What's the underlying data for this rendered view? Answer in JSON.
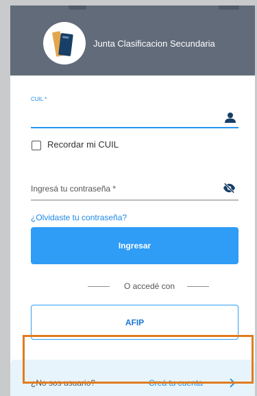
{
  "header": {
    "title": "Junta Clasificacion Secundaria",
    "logo_icon": "books-logo-icon"
  },
  "form": {
    "cuil_label": "CUIL *",
    "cuil_value": "",
    "cuil_icon": "person-icon",
    "remember_label": "Recordar mi CUIL",
    "remember_checked": false,
    "password_placeholder": "Ingresá tu contraseña *",
    "password_value": "",
    "password_icon": "visibility-off-icon",
    "forgot_password": "¿Olvidaste tu contraseña?",
    "submit_label": "Ingresar"
  },
  "alternate_login": {
    "divider_text": "O accedé con",
    "provider_label": "AFIP"
  },
  "footer": {
    "question": "¿No sos usuario?",
    "create_account": "Creá tu cuenta",
    "arrow_icon": "arrow-right-icon"
  },
  "colors": {
    "header": "#616b7a",
    "primary": "#2f9cf6",
    "link": "#1e88e5",
    "highlight": "#e07b1f",
    "footer_background": "#e8f4fb"
  }
}
